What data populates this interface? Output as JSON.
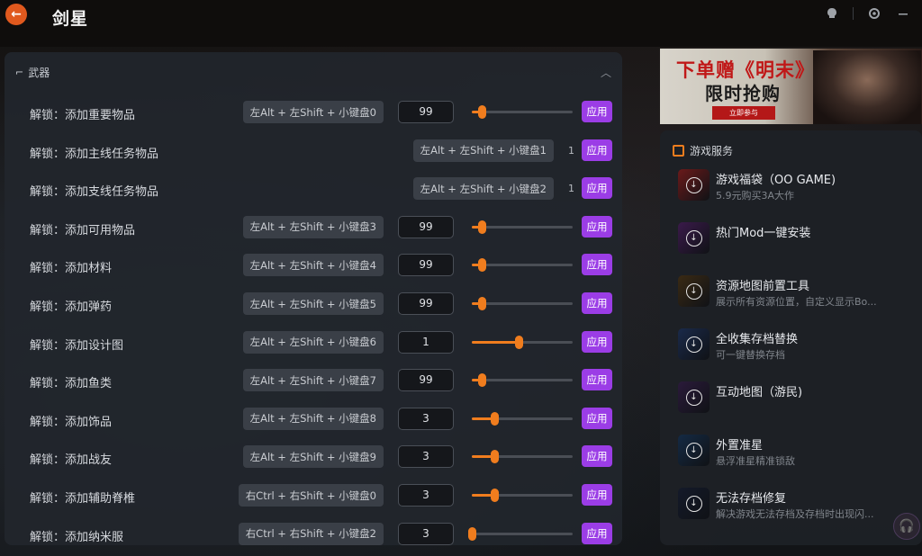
{
  "app": {
    "title": "剑星",
    "back_icon": "arrow-left-icon",
    "accent": "#e0591e"
  },
  "titlebar_icons": [
    "skull-icon",
    "settings-icon",
    "minimize-icon"
  ],
  "section": {
    "title": "武器",
    "icon": "gun-icon"
  },
  "rows": [
    {
      "label": "解锁：添加重要物品",
      "hotkey": "左Alt + 左Shift + 小键盘0",
      "value": "99",
      "slider": 0.1,
      "apply": "应用",
      "type": "input"
    },
    {
      "label": "解锁：添加主线任务物品",
      "hotkey": "左Alt + 左Shift + 小键盘1",
      "value": "1",
      "apply": "应用",
      "type": "plain"
    },
    {
      "label": "解锁：添加支线任务物品",
      "hotkey": "左Alt + 左Shift + 小键盘2",
      "value": "1",
      "apply": "应用",
      "type": "plain"
    },
    {
      "label": "解锁：添加可用物品",
      "hotkey": "左Alt + 左Shift + 小键盘3",
      "value": "99",
      "slider": 0.1,
      "apply": "应用",
      "type": "input"
    },
    {
      "label": "解锁：添加材料",
      "hotkey": "左Alt + 左Shift + 小键盘4",
      "value": "99",
      "slider": 0.1,
      "apply": "应用",
      "type": "input"
    },
    {
      "label": "解锁：添加弹药",
      "hotkey": "左Alt + 左Shift + 小键盘5",
      "value": "99",
      "slider": 0.1,
      "apply": "应用",
      "type": "input"
    },
    {
      "label": "解锁：添加设计图",
      "hotkey": "左Alt + 左Shift + 小键盘6",
      "value": "1",
      "slider": 0.46,
      "apply": "应用",
      "type": "input"
    },
    {
      "label": "解锁：添加鱼类",
      "hotkey": "左Alt + 左Shift + 小键盘7",
      "value": "99",
      "slider": 0.1,
      "apply": "应用",
      "type": "input"
    },
    {
      "label": "解锁：添加饰品",
      "hotkey": "左Alt + 左Shift + 小键盘8",
      "value": "3",
      "slider": 0.22,
      "apply": "应用",
      "type": "input"
    },
    {
      "label": "解锁：添加战友",
      "hotkey": "左Alt + 左Shift + 小键盘9",
      "value": "3",
      "slider": 0.22,
      "apply": "应用",
      "type": "input"
    },
    {
      "label": "解锁：添加辅助脊椎",
      "hotkey": "右Ctrl + 右Shift + 小键盘0",
      "value": "3",
      "slider": 0.22,
      "apply": "应用",
      "type": "input"
    },
    {
      "label": "解锁：添加纳米服",
      "hotkey": "右Ctrl + 右Shift + 小键盘2",
      "value": "3",
      "slider": 0.0,
      "apply": "应用",
      "type": "input"
    }
  ],
  "banner": {
    "line1": "下单赠《明末》",
    "line2": "限时抢购",
    "cta": "立即参与"
  },
  "services": {
    "title": "游戏服务",
    "items": [
      {
        "title": "游戏福袋（OO GAME)",
        "subtitle": "5.9元购买3A大作",
        "color": "#6a1a1a"
      },
      {
        "title": "热门Mod一键安装",
        "subtitle": "",
        "color": "#3a1a4a"
      },
      {
        "title": "资源地图前置工具",
        "subtitle": "展示所有资源位置，自定义显示Bo...",
        "color": "#3a2a14"
      },
      {
        "title": "全收集存档替换",
        "subtitle": "可一键替换存档",
        "color": "#1a2a4a"
      },
      {
        "title": "互动地图（游民)",
        "subtitle": "",
        "color": "#2a1a3a"
      },
      {
        "title": "外置准星",
        "subtitle": "悬浮准星精准锁敌",
        "color": "#142a44"
      },
      {
        "title": "无法存档修复",
        "subtitle": "解决游戏无法存档及存档时出现闪...",
        "color": "#141a2a"
      }
    ]
  }
}
